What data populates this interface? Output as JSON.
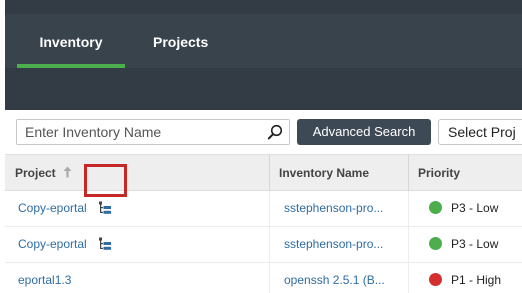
{
  "nav": {
    "tabs": [
      {
        "label": "Inventory",
        "active": true
      },
      {
        "label": "Projects",
        "active": false
      }
    ],
    "active_tab_color": "#4cae4c",
    "bar_color": "#333b44"
  },
  "filters": {
    "search": {
      "placeholder": "Enter Inventory Name",
      "value": "",
      "icon": "search-icon"
    },
    "advanced_search_label": "Advanced Search",
    "select_value": "Select Proj"
  },
  "table": {
    "columns": [
      {
        "label": "Project",
        "sort": "ascending",
        "sort_icon": "arrow-up-icon"
      },
      {
        "label": "Inventory Name"
      },
      {
        "label": "Priority"
      }
    ],
    "rows": [
      {
        "project": "Copy-eportal",
        "has_hierarchy_icon": true,
        "inventory": "sstephenson-pro...",
        "priority": "P3 - Low",
        "priority_color": "#4cae4c"
      },
      {
        "project": "Copy-eportal",
        "has_hierarchy_icon": true,
        "inventory": "sstephenson-pro...",
        "priority": "P3 - Low",
        "priority_color": "#4cae4c"
      },
      {
        "project": "eportal1.3",
        "has_hierarchy_icon": false,
        "inventory": "openssh 2.5.1 (B...",
        "priority": "P1 - High",
        "priority_color": "#d32f2f"
      }
    ]
  },
  "annotation": {
    "highlight_color": "#c62828"
  }
}
